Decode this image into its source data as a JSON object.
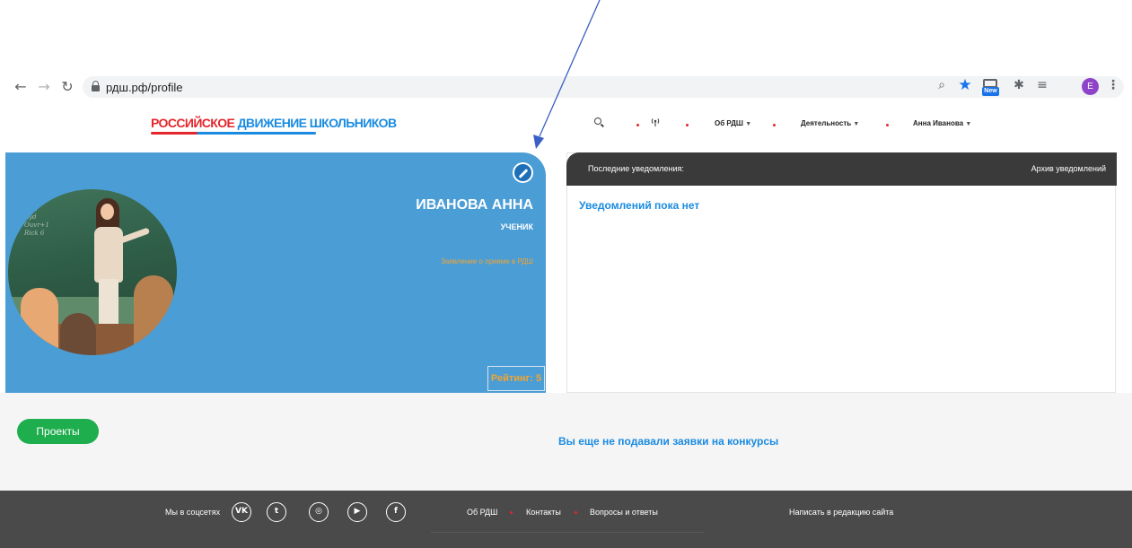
{
  "browser": {
    "url": "рдш.рф/profile",
    "profile_initial": "E",
    "new_badge": "New"
  },
  "site": {
    "logo_part1": "РОССИЙСКОЕ ",
    "logo_part2": "ДВИЖЕНИЕ ШКОЛЬНИКОВ",
    "nav": {
      "about": "Об РДШ",
      "activity": "Деятельность",
      "user": "Анна Иванова"
    }
  },
  "profile": {
    "name": "ИВАНОВА АННА",
    "role": "УЧЕНИК",
    "application_link": "Заявление о приеме в РДШ",
    "rating": "Рейтинг: 5"
  },
  "notifications": {
    "title": "Последние уведомления:",
    "archive": "Архив уведомлений",
    "empty": "Уведомлений пока нет"
  },
  "projects": {
    "button": "Проекты",
    "no_applications": "Вы еще не подавали заявки на конкурсы"
  },
  "footer": {
    "social_label": "Мы в соцсетях",
    "social": [
      "vk-icon",
      "twitter-icon",
      "instagram-icon",
      "youtube-icon",
      "facebook-icon"
    ],
    "links": [
      "Об РДШ",
      "Контакты",
      "Вопросы и ответы"
    ],
    "write_editor": "Написать в редакцию сайта"
  },
  "colors": {
    "profile_bg": "#4b9dd6",
    "accent_orange": "#f2a52f",
    "accent_blue": "#1a8be0",
    "green_button": "#1fae4e",
    "footer_bg": "#4a4a4a",
    "notif_header": "#3a3a3a"
  }
}
